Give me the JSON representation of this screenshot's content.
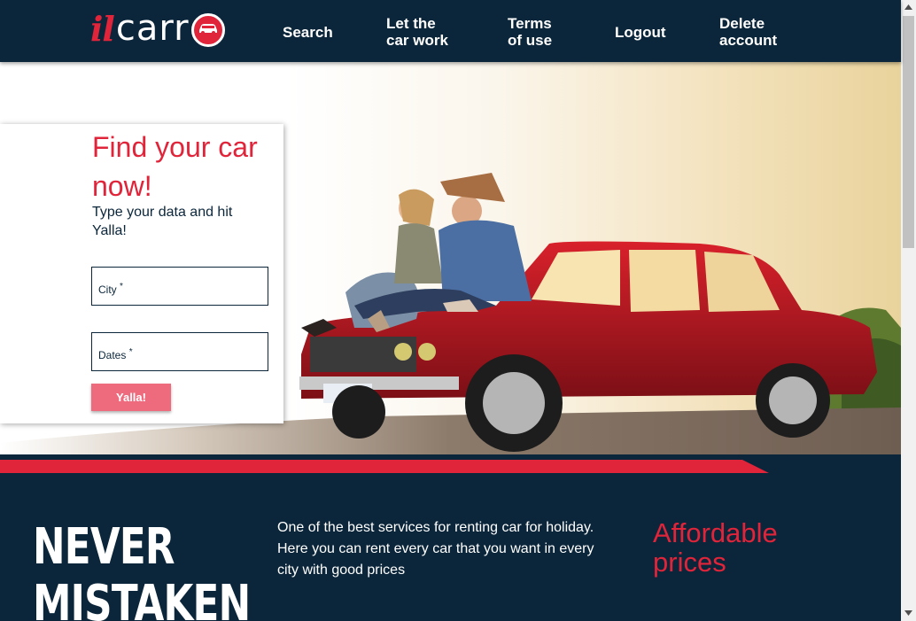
{
  "header": {
    "logo": {
      "prefix": "il",
      "main": "carr"
    },
    "nav": [
      {
        "line1": "Search",
        "line2": ""
      },
      {
        "line1": "Let the",
        "line2": "car work"
      },
      {
        "line1": "Terms",
        "line2": "of use"
      },
      {
        "line1": "Logout",
        "line2": ""
      },
      {
        "line1": "Delete",
        "line2": "account"
      }
    ]
  },
  "search_card": {
    "title": "Find your car now!",
    "subtitle": "Type your data and hit Yalla!",
    "city_label": "City",
    "dates_label": "Dates",
    "required_mark": "*",
    "button_label": "Yalla!"
  },
  "promo": {
    "headline_line1": "NEVER",
    "headline_line2": "MISTAKEN",
    "description": "One of the best services for renting car for holiday. Here you can rent every car that you want in every city with good prices",
    "affordable_title": "Affordable prices"
  },
  "colors": {
    "navy": "#0b263a",
    "brand_red": "#e0243a",
    "button_pink": "#ee6a7d"
  }
}
